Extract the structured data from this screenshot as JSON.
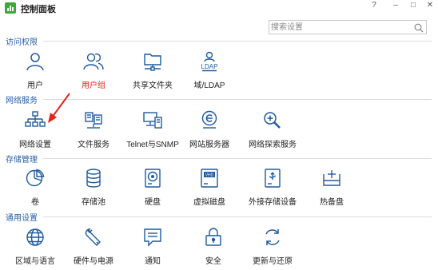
{
  "window": {
    "title": "控制面板",
    "help_label": "?",
    "minimize_label": "–",
    "maximize_label": "□",
    "close_label": "✕"
  },
  "search": {
    "placeholder": "搜索设置"
  },
  "colors": {
    "icon": "#1f5aa0",
    "section_title": "#2a5fa8",
    "highlight_label": "#e2231a",
    "pointer_arrow": "#e2231a"
  },
  "sections": [
    {
      "title": "访问权限",
      "items": [
        {
          "label": "用户",
          "icon": "user-icon"
        },
        {
          "label": "用户组",
          "icon": "user-group-icon",
          "highlight": true
        },
        {
          "label": "共享文件夹",
          "icon": "shared-folder-icon"
        },
        {
          "label": "域/LDAP",
          "icon": "ldap-icon",
          "icon_text": "LDAP"
        }
      ]
    },
    {
      "title": "网络服务",
      "items": [
        {
          "label": "网络设置",
          "icon": "network-icon"
        },
        {
          "label": "文件服务",
          "icon": "file-service-icon"
        },
        {
          "label": "Telnet与SNMP",
          "icon": "telnet-icon"
        },
        {
          "label": "网站服务器",
          "icon": "web-server-icon"
        },
        {
          "label": "网络探索服务",
          "icon": "discovery-icon"
        }
      ]
    },
    {
      "title": "存储管理",
      "items": [
        {
          "label": "卷",
          "icon": "volume-icon"
        },
        {
          "label": "存储池",
          "icon": "storage-pool-icon"
        },
        {
          "label": "硬盘",
          "icon": "hard-disk-icon"
        },
        {
          "label": "虚拟磁盘",
          "icon": "virtual-disk-icon",
          "icon_text": "VHD"
        },
        {
          "label": "外接存储设备",
          "icon": "external-storage-icon"
        },
        {
          "label": "热备盘",
          "icon": "hot-spare-icon"
        }
      ]
    },
    {
      "title": "通用设置",
      "items": [
        {
          "label": "区域与语言",
          "icon": "globe-icon"
        },
        {
          "label": "硬件与电源",
          "icon": "wrench-icon"
        },
        {
          "label": "通知",
          "icon": "notification-icon"
        },
        {
          "label": "安全",
          "icon": "lock-icon"
        },
        {
          "label": "更新与还原",
          "icon": "update-icon"
        }
      ]
    }
  ]
}
